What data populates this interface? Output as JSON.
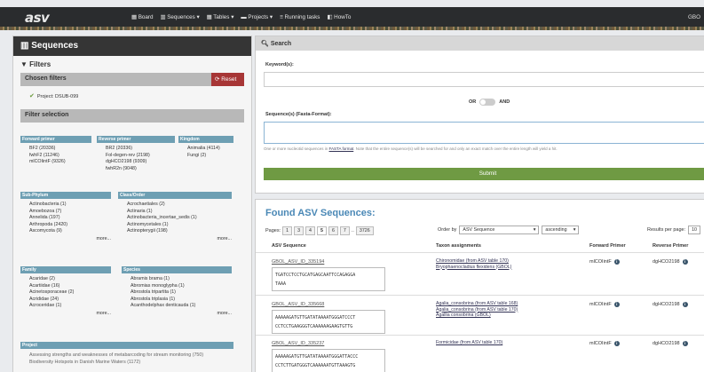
{
  "navbar": {
    "logo": "asv",
    "menu": [
      "Board",
      "Sequences",
      "Tables",
      "Projects",
      "Running tasks",
      "HowTo"
    ],
    "right": "GBO"
  },
  "left": {
    "title": "Sequences",
    "filters_title": "Filters",
    "chosen_filters": "Chosen filters",
    "reset": "Reset",
    "chosen_item": "Project: DSUB-099",
    "filter_selection": "Filter selection",
    "groups": {
      "forward_primer": {
        "title": "Forward primer",
        "items": [
          "BF2 (20336)",
          "fwhF2 (11246)",
          "mlCOIintF (9326)"
        ]
      },
      "reverse_primer": {
        "title": "Reverse primer",
        "items": [
          "BR2 (20336)",
          "Fol-degen-rev (2198)",
          "dgHCO2198 (9309)",
          "fwhR2n (9048)"
        ]
      },
      "kingdom": {
        "title": "Kingdom",
        "items": [
          "Animalia (4114)",
          "Fungi (2)"
        ]
      },
      "subphylum": {
        "title": "Sub-Phylum",
        "items": [
          "Actinobacteria (1)",
          "Amoebozoa (7)",
          "Annelida (197)",
          "Arthropoda (2420)",
          "Ascomycota (9)"
        ],
        "more": "more..."
      },
      "classorder": {
        "title": "Class/Order",
        "items": [
          "Acrochaetiales (2)",
          "Actinaria (1)",
          "Actinobacteria_incertae_sedis (1)",
          "Actinomycetales (1)",
          "Actinopterygii (198)"
        ],
        "more": "more..."
      },
      "family": {
        "title": "Family",
        "items": [
          "Acaridae (2)",
          "Acartiidae (16)",
          "Acinetosporaceae (2)",
          "Acrididae (24)",
          "Acroceridae (1)"
        ],
        "more": "more..."
      },
      "species": {
        "title": "Species",
        "items": [
          "Abramis brama (1)",
          "Abromias monoglypha (1)",
          "Abrostola tripartita (1)",
          "Abrostola triplasia (1)",
          "Acanthodelphax denticauda (1)"
        ],
        "more": "more..."
      },
      "project": {
        "title": "Project",
        "items": [
          "Assessing strengths and weaknesses of metabarcoding for stream monitoring (750)",
          "Biodiversity Hotspots in Danish Marine Waters (1172)"
        ]
      }
    }
  },
  "search": {
    "title": "Search",
    "keywords_label": "Keyword(s):",
    "or": "OR",
    "and": "AND",
    "sequence_label": "Sequence(s) (Fasta-Format):",
    "help_pre": "One or more nucleotid sequences in ",
    "help_link": "FASTA format",
    "help_post": ". Note that the entire sequence(s) will be searched for and only an exact match over the entire length will yield a hit.",
    "submit": "Submit"
  },
  "results": {
    "title": "Found ASV Sequences:",
    "pages_label": "Pages:",
    "pages": [
      "1",
      "3",
      "4",
      "5",
      "6",
      "7",
      "3726"
    ],
    "order_label": "Order by",
    "order_value": "ASV Sequence",
    "direction": "ascending",
    "rpp_label": "Results per page:",
    "rpp_value": "10",
    "columns": [
      "ASV Sequence",
      "Taxon assignments",
      "Forward Primer",
      "Reverse Primer"
    ],
    "rows": [
      {
        "id": "GBOL_ASV_ID_335194",
        "seq": [
          "TGATCCTCCTGCATGAGCAATTCCAGAGGA",
          "TAAA"
        ],
        "taxa": [
          "Chironomidae (from ASV table 170)",
          "Bryophaenocladius flexidens (GBOL)"
        ],
        "fp": "mlCOIintF",
        "rp": "dgHCO2198"
      },
      {
        "id": "GBOL_ASV_ID_335668",
        "seq": [
          "AAAAAGATGTTGATATAAAATGGGATCCCT",
          "CCTCCTGAAGGGTCAAAAAAGAAGTGTTG"
        ],
        "taxa": [
          "Agalia_consobrina (from ASV table 168)",
          "Agalia_consobrina (from ASV table 170)",
          "Agallia consobrina (GBOL)"
        ],
        "fp": "mlCOIintF",
        "rp": "dgHCO2198"
      },
      {
        "id": "GBOL_ASV_ID_335237",
        "seq": [
          "AAAAAGATGTTGATATAAAATGGGATTACCC",
          "CCTCTTGATGGGTCAAAAAATGTTAAAGTG"
        ],
        "taxa": [
          "Formicidae (from ASV table 170)"
        ],
        "fp": "mlCOIintF",
        "rp": "dgHCO2198"
      }
    ]
  }
}
